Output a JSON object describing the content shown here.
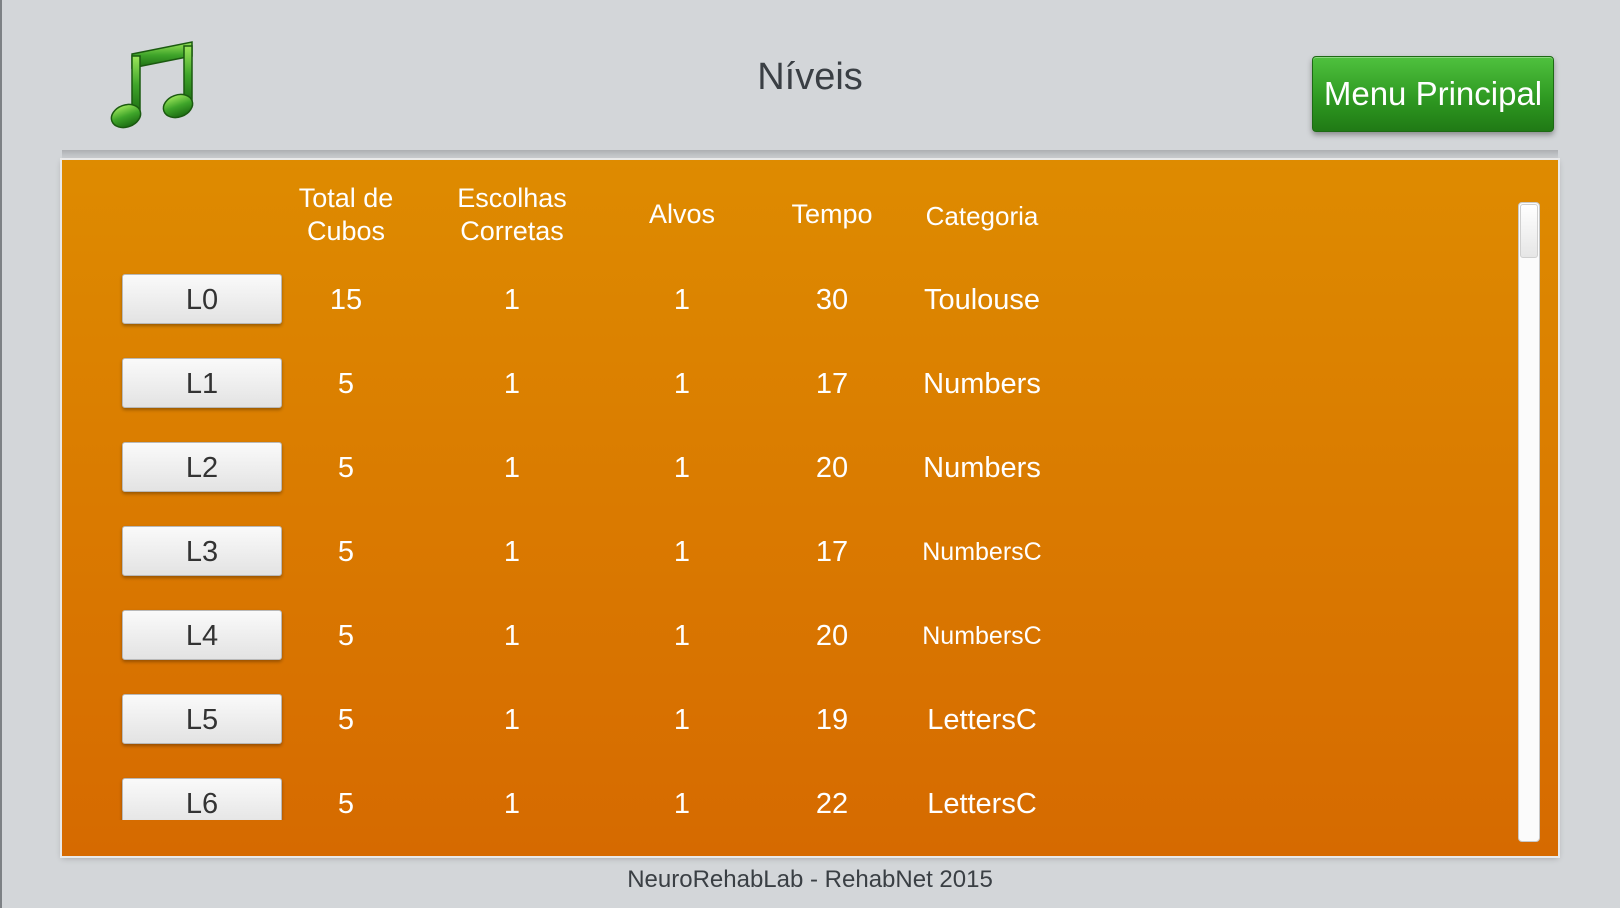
{
  "header": {
    "title": "Níveis",
    "menu_button_label": "Menu Principal",
    "music_icon": "music-note-icon"
  },
  "table": {
    "columns": {
      "total_line1": "Total de",
      "total_line2": "Cubos",
      "correct_line1": "Escolhas",
      "correct_line2": "Corretas",
      "targets": "Alvos",
      "time": "Tempo",
      "category": "Categoria"
    },
    "rows": [
      {
        "level": "L0",
        "total": "15",
        "correct": "1",
        "targets": "1",
        "time": "30",
        "category": "Toulouse"
      },
      {
        "level": "L1",
        "total": "5",
        "correct": "1",
        "targets": "1",
        "time": "17",
        "category": "Numbers"
      },
      {
        "level": "L2",
        "total": "5",
        "correct": "1",
        "targets": "1",
        "time": "20",
        "category": "Numbers"
      },
      {
        "level": "L3",
        "total": "5",
        "correct": "1",
        "targets": "1",
        "time": "17",
        "category": "NumbersC"
      },
      {
        "level": "L4",
        "total": "5",
        "correct": "1",
        "targets": "1",
        "time": "20",
        "category": "NumbersC"
      },
      {
        "level": "L5",
        "total": "5",
        "correct": "1",
        "targets": "1",
        "time": "19",
        "category": "LettersC"
      },
      {
        "level": "L6",
        "total": "5",
        "correct": "1",
        "targets": "1",
        "time": "22",
        "category": "LettersC"
      }
    ]
  },
  "footer": {
    "credit": "NeuroRehabLab - RehabNet 2015"
  },
  "colors": {
    "panel_top": "#de8b00",
    "panel_bottom": "#d66a00",
    "menu_button": "#2f9a22",
    "background": "#d3d6d9"
  }
}
